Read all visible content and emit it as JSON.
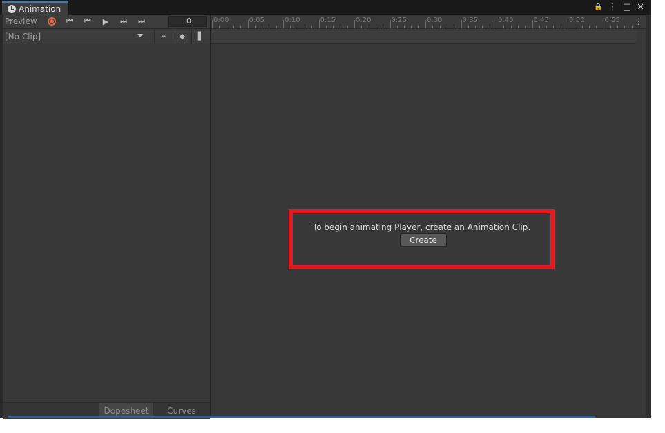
{
  "window": {
    "tab_title": "Animation"
  },
  "window_controls": {
    "lock": "🔒",
    "more": "⋮",
    "maximize": "□",
    "close": "✕"
  },
  "toolbar": {
    "preview_label": "Preview",
    "frame_value": "0",
    "icons": {
      "first": "⏮",
      "prev": "⏮",
      "play": "▶",
      "next": "⏭",
      "last": "⏭"
    },
    "clip_selector": "[No Clip]",
    "key_icons": {
      "filter": "⌖",
      "add_key": "◆",
      "add_event": "▌"
    }
  },
  "timeline": {
    "ticks": [
      "0:00",
      "0:05",
      "0:10",
      "0:15",
      "0:20",
      "0:25",
      "0:30",
      "0:35",
      "0:40",
      "0:45",
      "0:50",
      "0:55"
    ]
  },
  "empty_state": {
    "message": "To begin animating Player, create an Animation Clip.",
    "create_label": "Create"
  },
  "bottom_tabs": {
    "dopesheet": "Dopesheet",
    "curves": "Curves"
  },
  "colors": {
    "accent": "#3a79bb",
    "record": "#d86a4a",
    "highlight": "#e21b23",
    "background": "#383838"
  }
}
